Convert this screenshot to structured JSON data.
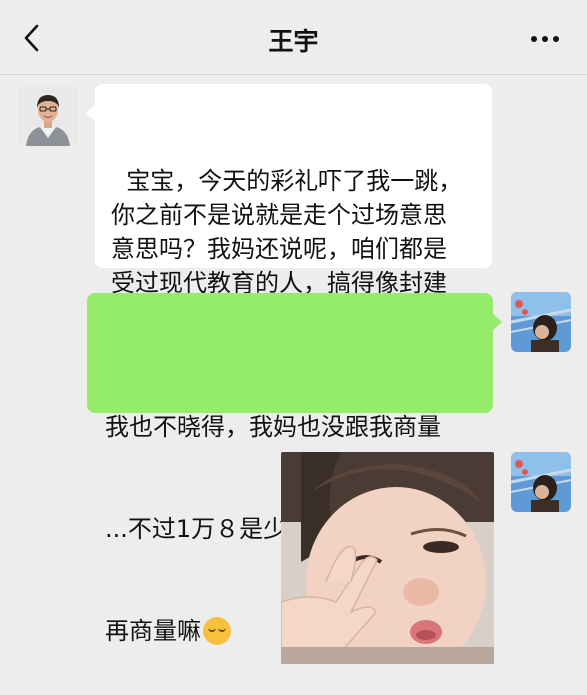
{
  "header": {
    "title": "王宇",
    "back_icon": "chevron-left-icon",
    "more_icon": "more-dots-icon"
  },
  "messages": [
    {
      "sender": "王宇",
      "side": "left",
      "text": "宝宝，今天的彩礼吓了我一跳，\n你之前不是说就是走个过场意思\n意思吗？我妈还说呢，咱们都是\n受过现代教育的人，搞得像封建\n社会卖女儿一样"
    },
    {
      "sender": "me",
      "side": "right",
      "text_lines": [
        "我也不晓得，我妈也没跟我商量",
        "...不过1万８是少了点，你跟阿姨",
        "再商量嘛"
      ],
      "emoji": "grinning-squint-emoji"
    },
    {
      "sender": "me",
      "side": "right",
      "type": "image",
      "image_description": "child-making-peace-sign-photo"
    }
  ],
  "colors": {
    "background": "#ededed",
    "incoming_bubble": "#ffffff",
    "outgoing_bubble": "#95ec69"
  }
}
